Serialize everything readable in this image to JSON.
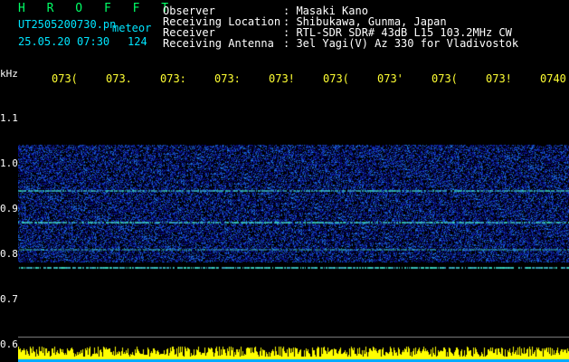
{
  "brand": "H R O F F T",
  "info": {
    "filename": "UT2505200730.pn",
    "tag": "meteor",
    "datetime": "25.05.20 07:30",
    "count": "124"
  },
  "header": {
    "rows": [
      {
        "label": "Observer",
        "value": ": Masaki Kano"
      },
      {
        "label": "Receiving Location",
        "value": ": Shibukawa, Gunma, Japan"
      },
      {
        "label": "Receiver",
        "value": ": RTL-SDR SDR# 43dB L15 103.2MHz CW"
      },
      {
        "label": "Receiving Antenna",
        "value": ": 3el Yagi(V) Az 330 for Vladivostok"
      }
    ]
  },
  "axis": {
    "unit": "kHz",
    "time_ticks": [
      "073(",
      "073.",
      "073:",
      "073:",
      "073!",
      "073(",
      "073'",
      "073(",
      "073!",
      "0740"
    ],
    "freq_ticks": [
      "1.1",
      "1.0",
      "0.9",
      "0.8",
      "0.7",
      "0.6"
    ]
  },
  "colors": {
    "background": "#000000",
    "spectrum_low": "#0a1a8c",
    "spectrum_high": "#2ee8ff",
    "signal_line": "#66ff99",
    "meter_bar": "#ffff00"
  }
}
